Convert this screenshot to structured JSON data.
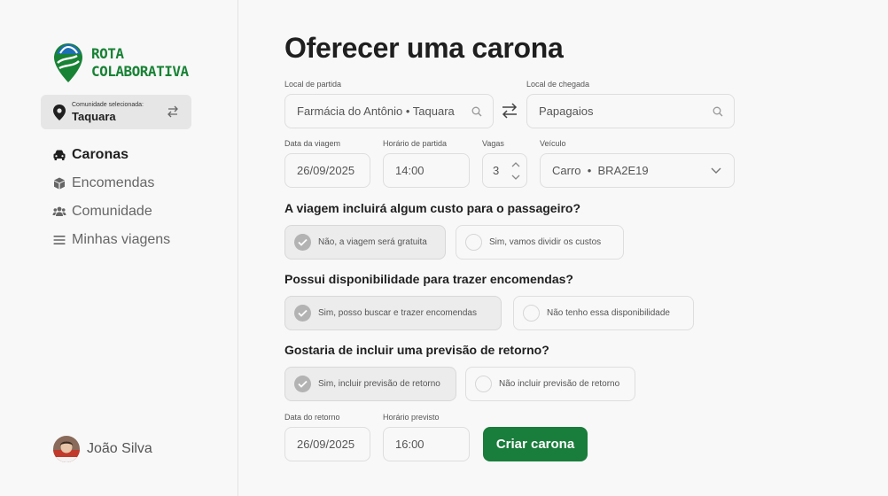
{
  "brand": {
    "line1": "ROTA",
    "line2": "COLABORATIVA",
    "color": "#188235"
  },
  "community": {
    "caption": "Comunidade selecionada:",
    "name": "Taquara"
  },
  "nav": [
    {
      "label": "Caronas",
      "icon": "car-icon",
      "active": true
    },
    {
      "label": "Encomendas",
      "icon": "package-icon",
      "active": false
    },
    {
      "label": "Comunidade",
      "icon": "people-icon",
      "active": false
    },
    {
      "label": "Minhas viagens",
      "icon": "list-icon",
      "active": false
    }
  ],
  "user": {
    "name": "João Silva"
  },
  "page": {
    "title": "Oferecer uma carona"
  },
  "form": {
    "origin": {
      "label": "Local de partida",
      "value": "Farmácia do Antônio • Taquara"
    },
    "destination": {
      "label": "Local de chegada",
      "value": "Papagaios"
    },
    "date": {
      "label": "Data da viagem",
      "value": "26/09/2025"
    },
    "time": {
      "label": "Horário de partida",
      "value": "14:00"
    },
    "seats": {
      "label": "Vagas",
      "value": "3"
    },
    "vehicle": {
      "label": "Veículo",
      "value": "Carro  •  BRA2E19"
    },
    "cost": {
      "question": "A viagem incluirá algum custo para o passageiro?",
      "options": [
        "Não, a viagem será gratuita",
        "Sim, vamos dividir os custos"
      ],
      "selected": 0
    },
    "parcels": {
      "question": "Possui disponibilidade para trazer encomendas?",
      "options": [
        "Sim, posso buscar e trazer encomendas",
        "Não tenho essa disponibilidade"
      ],
      "selected": 0
    },
    "return": {
      "question": "Gostaria de incluir uma previsão de retorno?",
      "options": [
        "Sim, incluir previsão de retorno",
        "Não incluir previsão de retorno"
      ],
      "selected": 0
    },
    "return_date": {
      "label": "Data do retorno",
      "value": "26/09/2025"
    },
    "return_time": {
      "label": "Horário previsto",
      "value": "16:00"
    },
    "submit_label": "Criar carona"
  },
  "colors": {
    "accent": "#197d3b",
    "brand_blue": "#1c6fb3",
    "selected_radio": "#b3b3b3"
  }
}
